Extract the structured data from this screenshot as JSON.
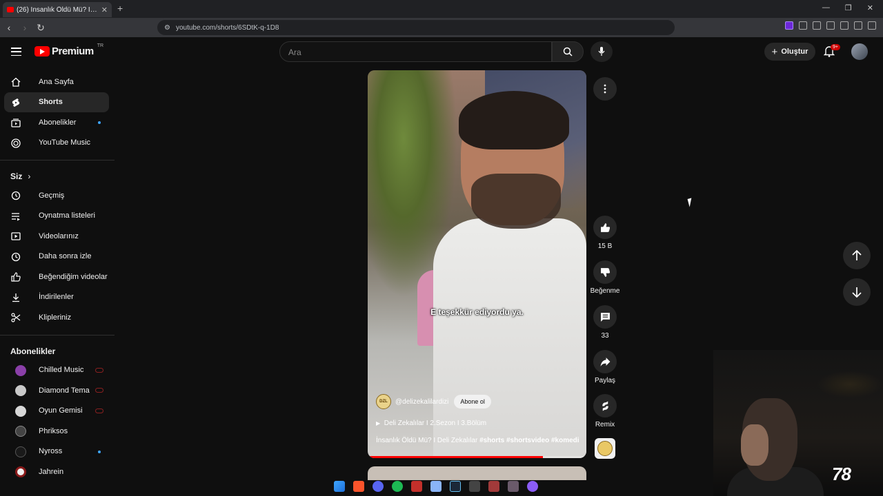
{
  "browser": {
    "tab_title": "(26) İnsanlık Öldü Mü? I Deli Zekalılar",
    "url": "youtube.com/shorts/6SDtK-q-1D8"
  },
  "header": {
    "logo_word": "Premium",
    "country": "TR",
    "search_placeholder": "Ara",
    "create_label": "Oluştur",
    "notif_badge": "9+"
  },
  "sidebar": {
    "main": [
      {
        "label": "Ana Sayfa",
        "icon": "home-icon"
      },
      {
        "label": "Shorts",
        "icon": "shorts-icon"
      },
      {
        "label": "Abonelikler",
        "icon": "subscriptions-icon"
      },
      {
        "label": "YouTube Music",
        "icon": "music-icon"
      }
    ],
    "you_heading": "Siz",
    "you": [
      {
        "label": "Geçmiş",
        "icon": "history-icon"
      },
      {
        "label": "Oynatma listeleri",
        "icon": "playlists-icon"
      },
      {
        "label": "Videolarınız",
        "icon": "your-videos-icon"
      },
      {
        "label": "Daha sonra izle",
        "icon": "watch-later-icon"
      },
      {
        "label": "Beğendiğim videolar",
        "icon": "liked-icon"
      },
      {
        "label": "İndirilenler",
        "icon": "download-icon"
      },
      {
        "label": "Klipleriniz",
        "icon": "clips-icon"
      }
    ],
    "subs_heading": "Abonelikler",
    "subs": [
      {
        "label": "Chilled Music",
        "color": "#8a3fa8"
      },
      {
        "label": "Diamond Tema",
        "color": "#c9c9c9"
      },
      {
        "label": "Oyun Gemisi",
        "color": "#d7d7d7"
      },
      {
        "label": "Phriksos",
        "color": "#444444"
      },
      {
        "label": "Nyross",
        "color": "#1a1a1a"
      },
      {
        "label": "Jahrein",
        "color": "#f1f1f1"
      }
    ]
  },
  "short": {
    "subtitle": "E teşekkür ediyordu ya.",
    "channel": "@delizekalilardizi",
    "channel_logo": "DZL",
    "subscribe": "Abone ol",
    "series": "Deli Zekalılar I 2.Sezon I 3.Bölüm",
    "desc_text": "İnsanlık Öldü Mü? I Deli Zekalılar ",
    "desc_tags": "#shorts #shortsvideo #komedi",
    "progress": 0.8
  },
  "actions": {
    "likes": "15 B",
    "dislike": "Beğenme",
    "comments": "33",
    "share": "Paylaş",
    "remix": "Remix"
  },
  "stream": {
    "viewers": "78"
  }
}
